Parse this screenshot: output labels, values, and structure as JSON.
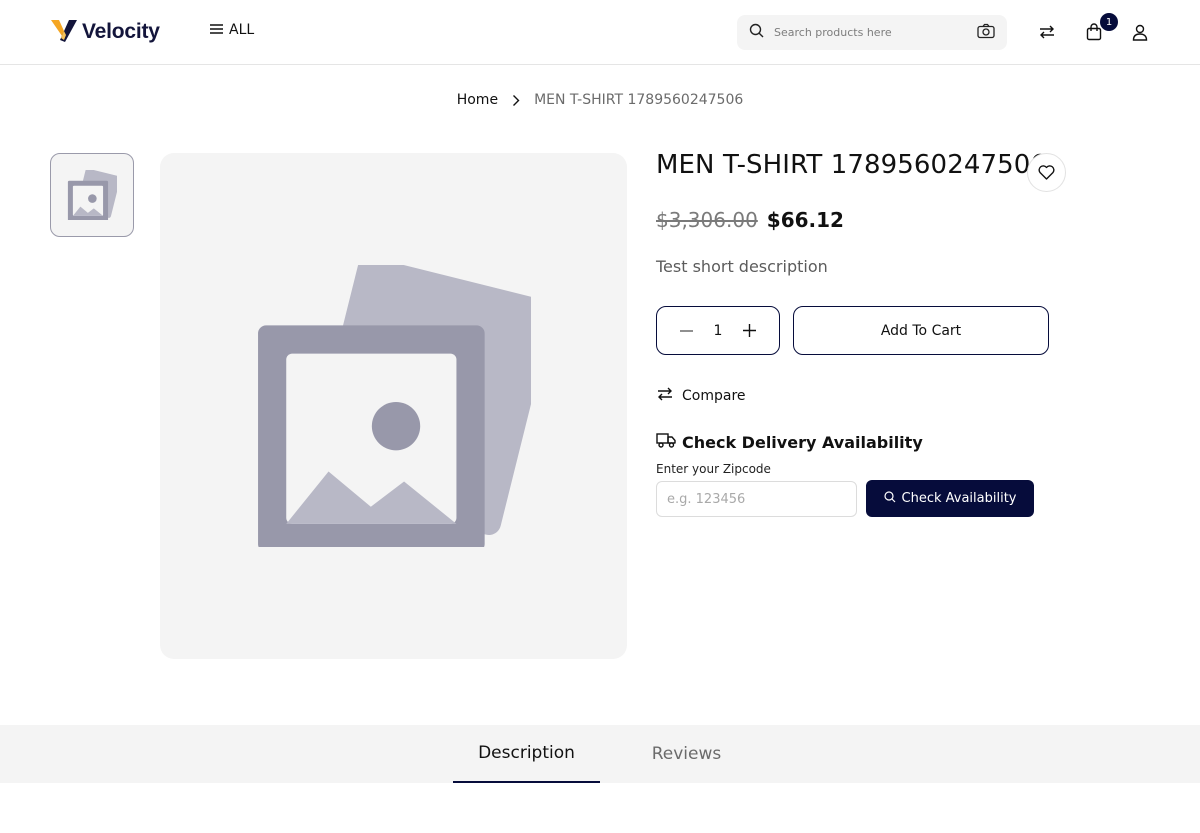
{
  "header": {
    "logo_text": "Velocity",
    "menu_label": "ALL",
    "search_placeholder": "Search products here",
    "cart_count": "1",
    "icons": [
      "menu-icon",
      "search-icon",
      "camera-icon",
      "compare-icon",
      "shopping-bag-icon",
      "user-icon"
    ]
  },
  "breadcrumb": {
    "home": "Home",
    "current": "MEN T-SHIRT 1789560247506"
  },
  "product": {
    "title": "MEN T-SHIRT 1789560247506",
    "old_price": "$3,306.00",
    "price": "$66.12",
    "short_description": "Test short description",
    "quantity": "1",
    "add_to_cart_label": "Add To Cart",
    "compare_label": "Compare"
  },
  "delivery": {
    "title": "Check Delivery Availability",
    "zip_label": "Enter your Zipcode",
    "zip_placeholder": "e.g. 123456",
    "button_label": "Check Availability"
  },
  "tabs": [
    {
      "label": "Description",
      "active": true
    },
    {
      "label": "Reviews",
      "active": false
    }
  ],
  "colors": {
    "brand_navy": "#060c3b",
    "logo_accent": "#f5a623",
    "placeholder_gray": "#9898aa",
    "surface": "#f4f4f4"
  }
}
